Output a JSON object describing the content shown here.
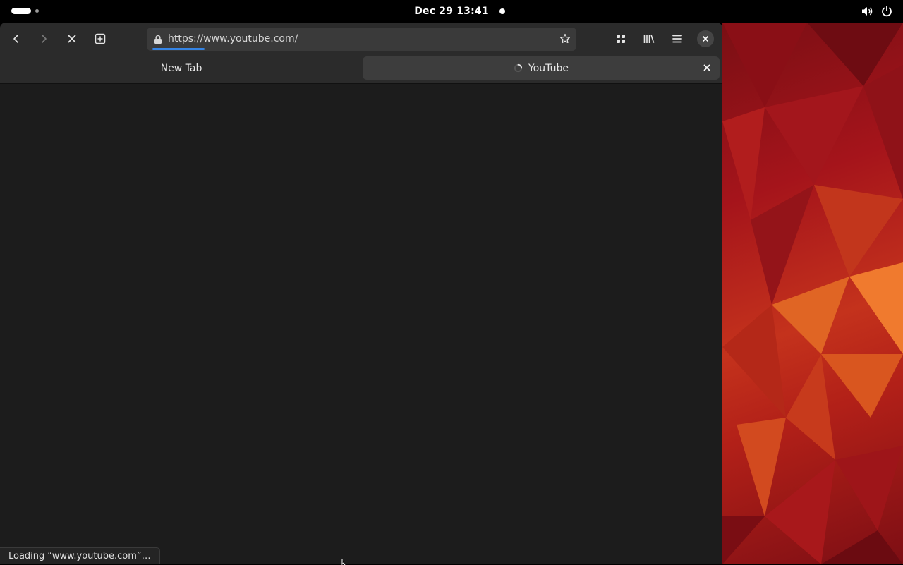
{
  "topbar": {
    "clock": "Dec 29  13:41",
    "icons": [
      "volume-icon",
      "power-icon"
    ]
  },
  "browser": {
    "toolbar": {
      "buttons": [
        "back-icon",
        "forward-icon",
        "stop-icon",
        "new-tab-icon",
        "tab-overview-icon",
        "library-icon",
        "menu-icon",
        "close-icon"
      ]
    },
    "url": {
      "value": "https://www.youtube.com/",
      "icon": "lock-icon",
      "bookmark_icon": "star-icon"
    },
    "tabs": [
      {
        "label": "New Tab",
        "active": false
      },
      {
        "label": "YouTube",
        "active": true,
        "loading": true
      }
    ],
    "status": "Loading “www.youtube.com”…"
  },
  "colors": {
    "accent": "#3584e4",
    "toolbar_bg": "#2b2b2b",
    "content_bg": "#1c1c1c"
  }
}
